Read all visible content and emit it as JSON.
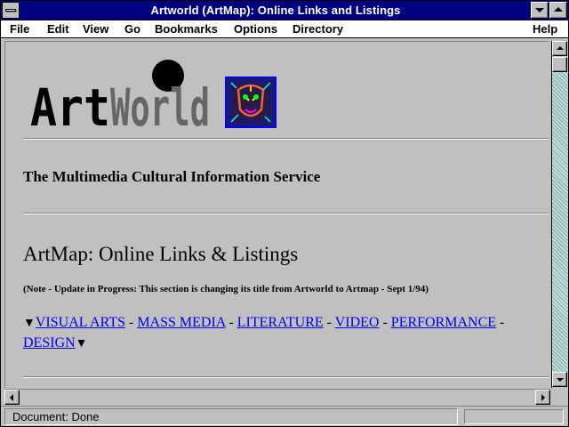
{
  "window": {
    "title": "Artworld (ArtMap): Online Links and Listings"
  },
  "menubar": {
    "items": [
      "File",
      "Edit",
      "View",
      "Go",
      "Bookmarks",
      "Options",
      "Directory",
      "Help"
    ]
  },
  "page": {
    "logo_text": "ArtWorld",
    "tagline": "The Multimedia Cultural Information Service",
    "heading": "ArtMap: Online Links & Listings",
    "note": "(Note - Update in Progress: This section is changing its title from Artworld to Artmap - Sept 1/94)",
    "links": [
      "VISUAL ARTS",
      "MASS MEDIA",
      "LITERATURE",
      "VIDEO",
      "PERFORMANCE",
      "DESIGN"
    ],
    "separator": " - ",
    "arrow_glyph": "▼"
  },
  "statusbar": {
    "text": "Document: Done"
  },
  "colors": {
    "titlebar": "#000080",
    "link": "#0000ee",
    "face": "#c0c0c0"
  }
}
